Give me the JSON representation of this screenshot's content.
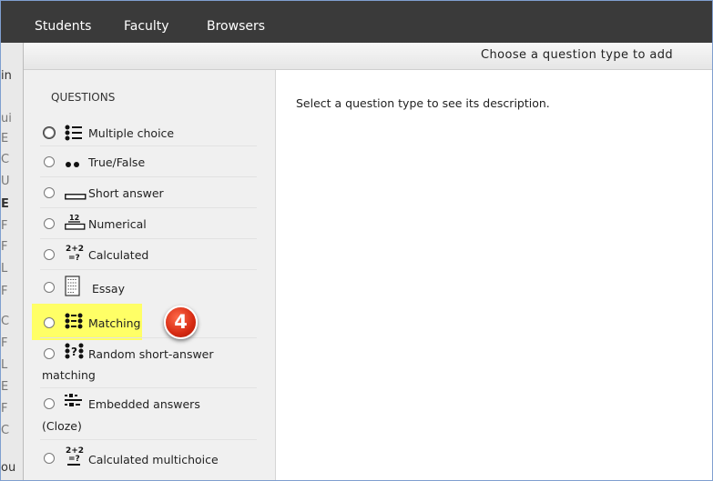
{
  "nav": {
    "students": "Students",
    "faculty": "Faculty",
    "browsers": "Browsers"
  },
  "background_fragments": [
    "in",
    "ui",
    "E",
    "C",
    "U",
    "E",
    "F",
    "F",
    "L",
    "F",
    "C",
    "F",
    "L",
    "E",
    "F",
    "C",
    "ou"
  ],
  "dialog": {
    "title": "Choose a question type to add",
    "section_heading": "QUESTIONS",
    "description": "Select a question type to see its description.",
    "options": [
      {
        "label": "Multiple choice",
        "icon": "multiple-choice-icon"
      },
      {
        "label": "True/False",
        "icon": "true-false-icon"
      },
      {
        "label": "Short answer",
        "icon": "short-answer-icon"
      },
      {
        "label": "Numerical",
        "icon": "numerical-icon",
        "icon_text": "12"
      },
      {
        "label": "Calculated",
        "icon": "calculated-icon",
        "icon_text": "2+2",
        "icon_text2": "=?"
      },
      {
        "label": "Essay",
        "icon": "essay-icon"
      },
      {
        "label": "Matching",
        "icon": "matching-icon"
      },
      {
        "label": "Random short-answer",
        "label2": "matching",
        "icon": "random-matching-icon",
        "icon_text": "?"
      },
      {
        "label": "Embedded answers",
        "label2": "(Cloze)",
        "icon": "cloze-icon"
      },
      {
        "label": "Calculated multichoice",
        "icon": "calculated-multichoice-icon",
        "icon_text": "2+2",
        "icon_text2": "=?"
      }
    ]
  },
  "callout": {
    "number": "4",
    "color": "#d62a12",
    "highlight_color": "#ffff66"
  }
}
